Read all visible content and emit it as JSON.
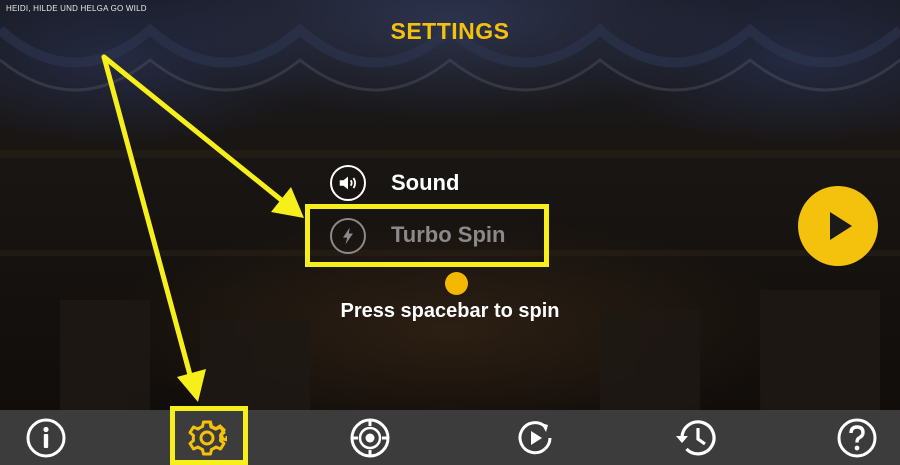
{
  "game": {
    "title": "HEIDI, HILDE UND HELGA GO WILD"
  },
  "settings": {
    "title": "SETTINGS",
    "options": [
      {
        "label": "Sound",
        "icon": "speaker-icon",
        "enabled": true
      },
      {
        "label": "Turbo Spin",
        "icon": "lightning-icon",
        "enabled": false
      }
    ],
    "hint": "Press spacebar to spin"
  },
  "toolbar": {
    "items": [
      {
        "icon": "info-icon",
        "active": false
      },
      {
        "icon": "gear-icon",
        "active": true
      },
      {
        "icon": "chip-icon",
        "active": false
      },
      {
        "icon": "autoplay-icon",
        "active": false
      },
      {
        "icon": "history-icon",
        "active": false
      },
      {
        "icon": "help-icon",
        "active": false
      }
    ]
  },
  "colors": {
    "accent": "#f4c20d",
    "annotation": "#f6ef1b",
    "toolbar_bg": "#3c3c3c"
  }
}
